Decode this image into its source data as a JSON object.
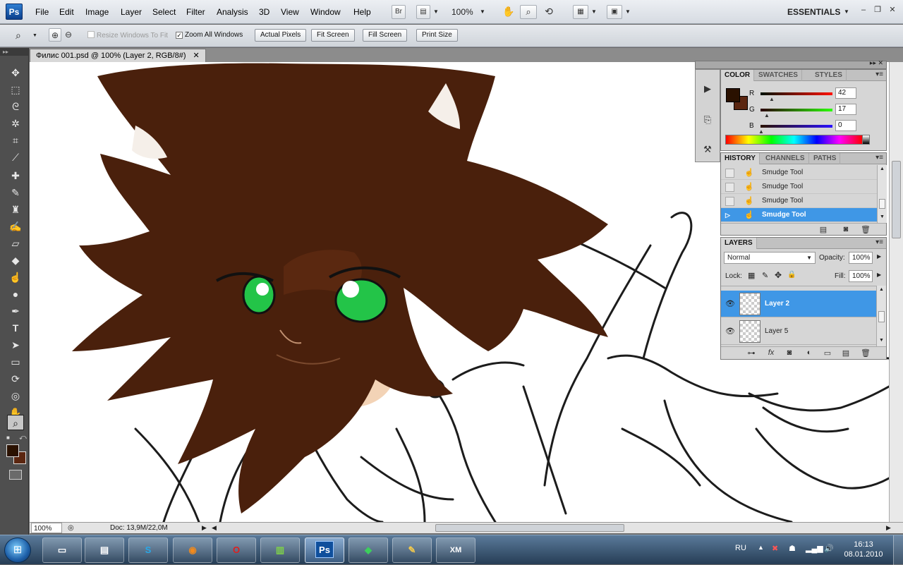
{
  "app": {
    "logo": "Ps",
    "essentials": "ESSENTIALS",
    "zoom": "100%",
    "bridge_label": "Br"
  },
  "menu": [
    "File",
    "Edit",
    "Image",
    "Layer",
    "Select",
    "Filter",
    "Analysis",
    "3D",
    "View",
    "Window",
    "Help"
  ],
  "options_bar": {
    "resize_windows": "Resize Windows To Fit",
    "zoom_all_windows": "Zoom All Windows",
    "actual_pixels": "Actual Pixels",
    "fit_screen": "Fit Screen",
    "fill_screen": "Fill Screen",
    "print_size": "Print Size"
  },
  "document": {
    "tab_title": "Филис 001.psd @ 100% (Layer 2, RGB/8#)",
    "close_glyph": "✕"
  },
  "status": {
    "zoom": "100%",
    "doc_size": "Doc: 13,9M/22,0M"
  },
  "color_panel": {
    "tabs": [
      "COLOR",
      "SWATCHES",
      "STYLES"
    ],
    "channels": [
      {
        "label": "R",
        "value": "42"
      },
      {
        "label": "G",
        "value": "17"
      },
      {
        "label": "B",
        "value": "0"
      }
    ]
  },
  "history_panel": {
    "tabs": [
      "HISTORY",
      "CHANNELS",
      "PATHS"
    ],
    "items": [
      "Smudge Tool",
      "Smudge Tool",
      "Smudge Tool",
      "Smudge Tool"
    ]
  },
  "layers_panel": {
    "tab": "LAYERS",
    "blend_mode": "Normal",
    "opacity_label": "Opacity:",
    "opacity": "100%",
    "lock_label": "Lock:",
    "fill_label": "Fill:",
    "fill": "100%",
    "layers": [
      "Layer 2",
      "Layer 5"
    ]
  },
  "colors": {
    "foreground": "#2a1100",
    "background": "#5b2610",
    "accent": "#3f97e6",
    "hair": "#4a200c",
    "skin": "#f3d3b6",
    "eyes": "#23c448"
  },
  "taskbar": {
    "apps": [
      "folder-icon",
      "explorer-icon",
      "skype-icon",
      "firefox-icon",
      "opera-icon",
      "winrar-icon",
      "Ps",
      "gem-icon",
      "paint-icon",
      "XM"
    ],
    "language": "RU",
    "time": "16:13",
    "date": "08.01.2010"
  }
}
